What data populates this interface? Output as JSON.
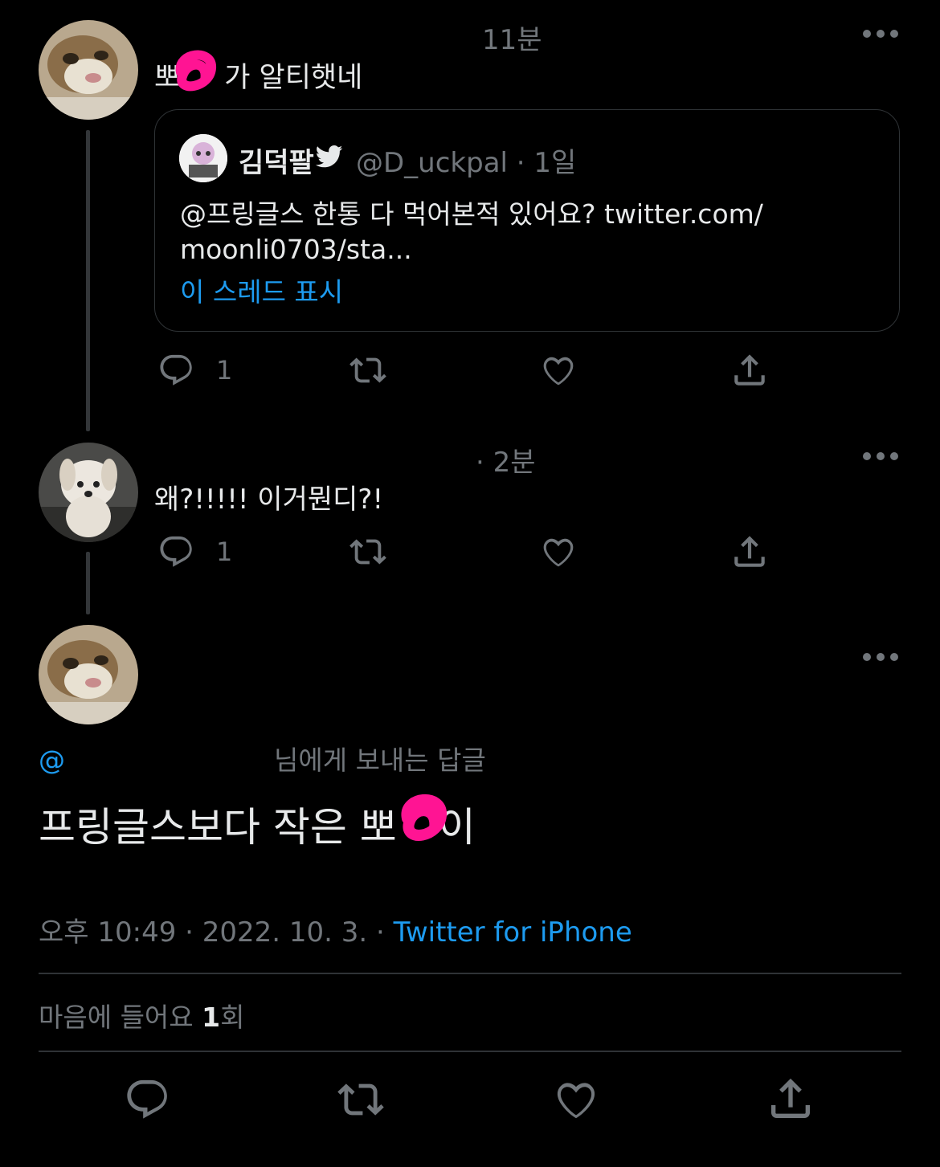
{
  "tweet1": {
    "time": "11분",
    "text_start": "뽀",
    "text_end": "가 알티햇네",
    "quote": {
      "name": "김덕팔",
      "handle_time": "@D_uckpal · 1일",
      "line1": "@프링글스 한통 다 먹어본적 있어요? twitter.com/",
      "line2": "moonli0703/sta...",
      "show_thread": "이 스레드 표시"
    },
    "actions": {
      "reply_count": "1",
      "retweet_count": "",
      "like_count": ""
    }
  },
  "tweet2": {
    "time": "· 2분",
    "text": "왜?!!!!! 이거뭔디?!",
    "actions": {
      "reply_count": "1",
      "retweet_count": "",
      "like_count": ""
    }
  },
  "main_tweet": {
    "reply_at": "@",
    "reply_to_suffix": "님에게 보내는 답글",
    "text_start": "프링글스보다 작은 뽀",
    "text_end": "이",
    "timestamp": "오후 10:49 · 2022. 10. 3. · ",
    "source": "Twitter for iPhone",
    "likes_prefix": "마음에 들어요 ",
    "likes_count": "1",
    "likes_suffix": "회"
  },
  "colors": {
    "background": "#000000",
    "text": "#e7e9ea",
    "muted": "#71767b",
    "link": "#1d9bf0",
    "censor_pink": "#ff1493"
  },
  "icons": [
    "reply-icon",
    "retweet-icon",
    "like-icon",
    "share-icon",
    "more-icon",
    "verified-bird-icon"
  ]
}
